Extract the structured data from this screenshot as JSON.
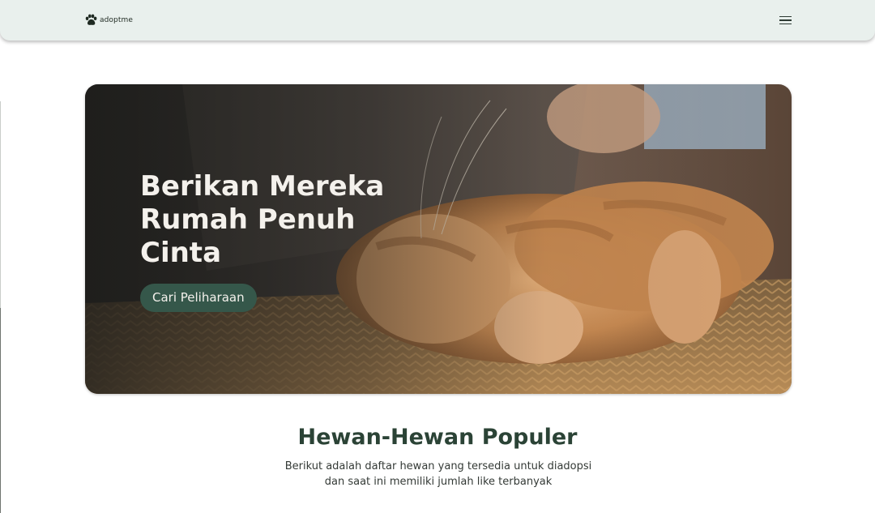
{
  "navbar": {
    "brand_icon": "paw-icon",
    "brand_name": "adoptme",
    "menu_icon": "hamburger-menu-icon"
  },
  "hero": {
    "title": "Berikan Mereka Rumah Penuh Cinta",
    "cta_label": "Cari Peliharaan",
    "image_subject": "orange tabby cat lying on back on woven rug",
    "button_color": "#35574a"
  },
  "popular": {
    "title": "Hewan-Hewan Populer",
    "description": "Berikut adalah daftar hewan yang tersedia untuk diadopsi dan saat ini memiliki jumlah like terbanyak"
  },
  "colors": {
    "navbar_bg": "#e9f0ed",
    "accent_green": "#35574a",
    "heading_green": "#2b4336"
  }
}
